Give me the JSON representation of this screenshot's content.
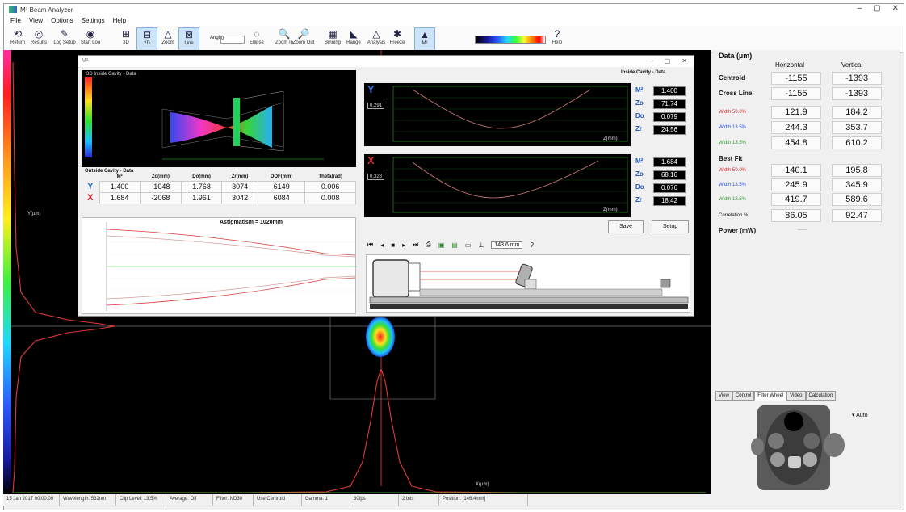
{
  "app": {
    "title": "M² Beam Analyzer",
    "window_controls": [
      "–",
      "▢",
      "✕"
    ],
    "menu": [
      "File",
      "View",
      "Options",
      "Settings",
      "Help"
    ]
  },
  "toolbar": {
    "buttons": [
      {
        "label": "Return",
        "icon": "back-icon",
        "glyph": "⟲"
      },
      {
        "label": "Results",
        "icon": "results-icon",
        "glyph": "◎"
      },
      {
        "label": "Log Setup",
        "icon": "log-setup-icon",
        "glyph": "✎"
      },
      {
        "label": "Start Log",
        "icon": "start-log-icon",
        "glyph": "◉"
      },
      {
        "label": "3D",
        "icon": "3d-icon",
        "glyph": "⊞"
      },
      {
        "label": "2D",
        "icon": "2d-icon",
        "glyph": "⊟"
      },
      {
        "label": "Zoom",
        "icon": "triangle-icon",
        "glyph": "△"
      },
      {
        "label": "Line",
        "icon": "line-icon",
        "glyph": "⊠"
      },
      {
        "label": "Ellipse",
        "icon": "ellipse-icon",
        "glyph": "◌"
      },
      {
        "label": "Zoom In",
        "icon": "zoom-in-icon",
        "glyph": "🔍"
      },
      {
        "label": "Zoom Out",
        "icon": "zoom-out-icon",
        "glyph": "🔎"
      },
      {
        "label": "Binning",
        "icon": "binning-icon",
        "glyph": "▦"
      },
      {
        "label": "Range",
        "icon": "range-icon",
        "glyph": "◣"
      },
      {
        "label": "Analysis",
        "icon": "analysis-icon",
        "glyph": "△"
      },
      {
        "label": "Freeze",
        "icon": "freeze-icon",
        "glyph": "✱"
      },
      {
        "label": "M²",
        "icon": "m2-icon",
        "glyph": "▲"
      },
      {
        "label": "Help",
        "icon": "help-icon",
        "glyph": "?"
      }
    ],
    "angle_label": "Angle",
    "angle_value": "0"
  },
  "main_view": {
    "y_axis_label": "Y(µm)",
    "x_axis_label": "X(µm)"
  },
  "statusbar": [
    "15 Jan 2017 00:00:00",
    "Wavelength: 532nm",
    "Clip Level: 13.5%",
    "Average: Off",
    "Filter: ND30",
    "Use Centroid",
    "Gamma: 1",
    "30fps",
    "2 bits",
    "Position: [146.4mm]"
  ],
  "results_panel": {
    "title": "Data (µm)",
    "col_horizontal": "Horizontal",
    "col_vertical": "Vertical",
    "rows": [
      {
        "label": "Centroid",
        "h": "-1155",
        "v": "-1393",
        "color": "#111111",
        "small": false
      },
      {
        "label": "Cross Line",
        "h": "-1155",
        "v": "-1393",
        "color": "#111111",
        "small": false
      },
      {
        "label": "Width 50.0%",
        "h": "121.9",
        "v": "184.2",
        "color": "#d42a2a",
        "small": true
      },
      {
        "label": "Width 13.5%",
        "h": "244.3",
        "v": "353.7",
        "color": "#2b4fd6",
        "small": true
      },
      {
        "label": "Width 13.5%",
        "h": "454.8",
        "v": "610.2",
        "color": "#3a9a3a",
        "small": true
      }
    ],
    "best_fit_label": "Best Fit",
    "best_fit_rows": [
      {
        "label": "Width 50.0%",
        "h": "140.1",
        "v": "195.8",
        "color": "#d42a2a"
      },
      {
        "label": "Width 13.5%",
        "h": "245.9",
        "v": "345.9",
        "color": "#2b4fd6"
      },
      {
        "label": "Width 13.5%",
        "h": "419.7",
        "v": "589.6",
        "color": "#3a9a3a"
      }
    ],
    "correlation_label": "Correlation %",
    "correlation_h": "86.05",
    "correlation_v": "92.47",
    "power_label": "Power (mW)",
    "power_value": "------",
    "tabs": [
      "View",
      "Control",
      "Filter Wheel",
      "Video",
      "Calculation"
    ],
    "active_tab": "Filter Wheel",
    "auto_label": "Auto"
  },
  "m2_dialog": {
    "title": "M²",
    "inside_cavity_3d_title": "3D Inside Cavity - Data",
    "inside_cavity_title": "Inside Cavity - Data",
    "outside_table_title": "Outside Cavity - Data",
    "table_headers": [
      "",
      "M²",
      "Zo(mm)",
      "Do(mm)",
      "Zr(mm)",
      "DOF(mm)",
      "Theta(rad)"
    ],
    "table_rows": [
      {
        "axis": "Y",
        "axis_color": "#2b6fd6",
        "cells": [
          "1.400",
          "-1048",
          "1.768",
          "3074",
          "6149",
          "0.006"
        ]
      },
      {
        "axis": "X",
        "axis_color": "#d42a2a",
        "cells": [
          "1.684",
          "-2068",
          "1.961",
          "3042",
          "6084",
          "0.008"
        ]
      }
    ],
    "astigmatism": "Astigmatism = 1020mm",
    "y_fit": {
      "axis": "Y",
      "field": "0.291",
      "params": [
        {
          "label": "M²",
          "value": "1.400"
        },
        {
          "label": "Zo",
          "value": "71.74"
        },
        {
          "label": "Do",
          "value": "0.079"
        },
        {
          "label": "Zr",
          "value": "24.56"
        }
      ],
      "x_caption": "Z(mm)"
    },
    "x_fit": {
      "axis": "X",
      "field": "0.328",
      "params": [
        {
          "label": "M²",
          "value": "1.684"
        },
        {
          "label": "Zo",
          "value": "68.16"
        },
        {
          "label": "Do",
          "value": "0.076"
        },
        {
          "label": "Zr",
          "value": "18.42"
        }
      ],
      "x_caption": "Z(mm)"
    },
    "save_button": "Save",
    "setup_button": "Setup",
    "stage_position": "143.6 mm",
    "player_help": "?"
  }
}
